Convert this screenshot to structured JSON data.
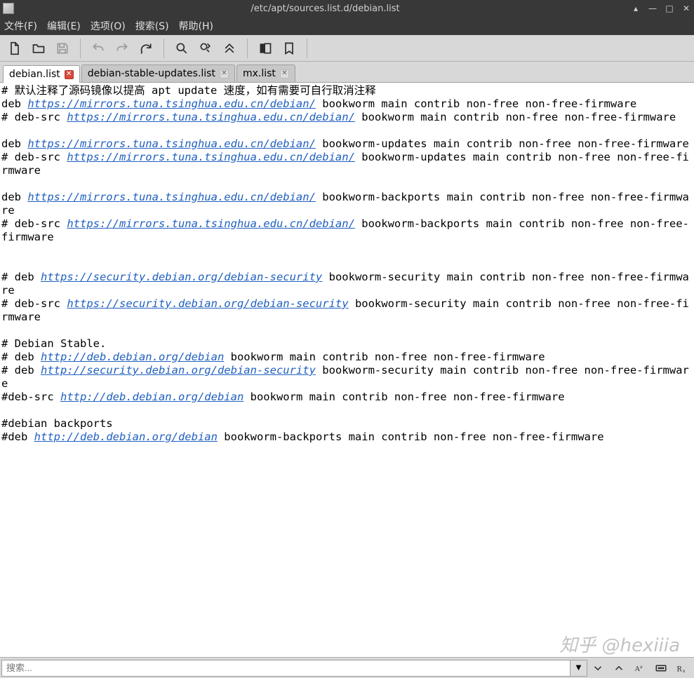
{
  "window": {
    "title": "/etc/apt/sources.list.d/debian.list"
  },
  "menu": {
    "file": "文件(F)",
    "edit": "编辑(E)",
    "options": "选项(O)",
    "search": "搜索(S)",
    "help": "帮助(H)"
  },
  "tabs": [
    {
      "label": "debian.list",
      "active": true
    },
    {
      "label": "debian-stable-updates.list",
      "active": false
    },
    {
      "label": "mx.list",
      "active": false
    }
  ],
  "editor": {
    "segments": [
      {
        "t": "text",
        "v": "# 默认注释了源码镜像以提高 apt update 速度，如有需要可自行取消注释\n"
      },
      {
        "t": "text",
        "v": "deb "
      },
      {
        "t": "link",
        "v": "https://mirrors.tuna.tsinghua.edu.cn/debian/"
      },
      {
        "t": "text",
        "v": " bookworm main contrib non-free non-free-firmware\n"
      },
      {
        "t": "text",
        "v": "# deb-src "
      },
      {
        "t": "link",
        "v": "https://mirrors.tuna.tsinghua.edu.cn/debian/"
      },
      {
        "t": "text",
        "v": " bookworm main contrib non-free non-free-firmware\n"
      },
      {
        "t": "text",
        "v": "\n"
      },
      {
        "t": "text",
        "v": "deb "
      },
      {
        "t": "link",
        "v": "https://mirrors.tuna.tsinghua.edu.cn/debian/"
      },
      {
        "t": "text",
        "v": " bookworm-updates main contrib non-free non-free-firmware\n"
      },
      {
        "t": "text",
        "v": "# deb-src "
      },
      {
        "t": "link",
        "v": "https://mirrors.tuna.tsinghua.edu.cn/debian/"
      },
      {
        "t": "text",
        "v": " bookworm-updates main contrib non-free non-free-firmware\n"
      },
      {
        "t": "text",
        "v": "\n"
      },
      {
        "t": "text",
        "v": "deb "
      },
      {
        "t": "link",
        "v": "https://mirrors.tuna.tsinghua.edu.cn/debian/"
      },
      {
        "t": "text",
        "v": " bookworm-backports main contrib non-free non-free-firmware\n"
      },
      {
        "t": "text",
        "v": "# deb-src "
      },
      {
        "t": "link",
        "v": "https://mirrors.tuna.tsinghua.edu.cn/debian/"
      },
      {
        "t": "text",
        "v": " bookworm-backports main contrib non-free non-free-firmware\n"
      },
      {
        "t": "text",
        "v": "\n\n"
      },
      {
        "t": "text",
        "v": "# deb "
      },
      {
        "t": "link",
        "v": "https://security.debian.org/debian-security"
      },
      {
        "t": "text",
        "v": " bookworm-security main contrib non-free non-free-firmware\n"
      },
      {
        "t": "text",
        "v": "# deb-src "
      },
      {
        "t": "link",
        "v": "https://security.debian.org/debian-security"
      },
      {
        "t": "text",
        "v": " bookworm-security main contrib non-free non-free-firmware\n"
      },
      {
        "t": "text",
        "v": "\n"
      },
      {
        "t": "text",
        "v": "# Debian Stable.\n"
      },
      {
        "t": "text",
        "v": "# deb "
      },
      {
        "t": "link",
        "v": "http://deb.debian.org/debian"
      },
      {
        "t": "text",
        "v": " bookworm main contrib non-free non-free-firmware\n"
      },
      {
        "t": "text",
        "v": "# deb "
      },
      {
        "t": "link",
        "v": "http://security.debian.org/debian-security"
      },
      {
        "t": "text",
        "v": " bookworm-security main contrib non-free non-free-firmware\n"
      },
      {
        "t": "text",
        "v": "#deb-src "
      },
      {
        "t": "link",
        "v": "http://deb.debian.org/debian"
      },
      {
        "t": "text",
        "v": " bookworm main contrib non-free non-free-firmware\n"
      },
      {
        "t": "text",
        "v": "\n"
      },
      {
        "t": "text",
        "v": "#debian backports\n"
      },
      {
        "t": "text",
        "v": "#deb "
      },
      {
        "t": "link",
        "v": "http://deb.debian.org/debian"
      },
      {
        "t": "text",
        "v": " bookworm-backports main contrib non-free non-free-firmware\n"
      }
    ]
  },
  "search": {
    "placeholder": "搜索..."
  },
  "watermark": "知乎 @hexiiia"
}
